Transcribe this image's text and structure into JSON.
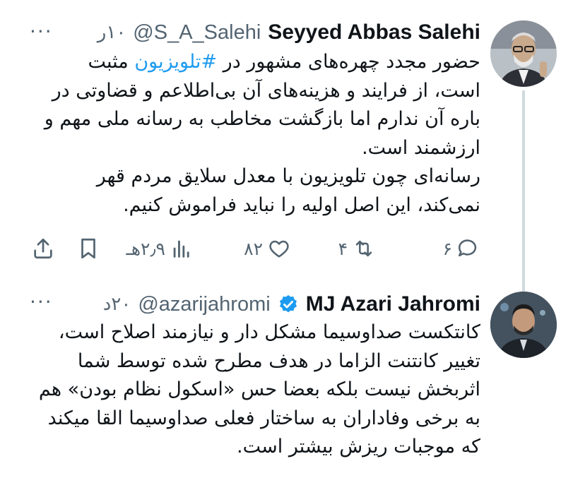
{
  "tweets": [
    {
      "name": "Seyyed Abbas Salehi",
      "handle": "@S_A_Salehi",
      "time": "۱۰ر",
      "verified": false,
      "text_line1_pre": "حضور مجدد چهره‌های مشهور در ",
      "hashtag": "#تلویزیون",
      "text_line1_post": " مثبت",
      "text_rest": "است، از فرایند و هزینه‌های آن بی‌اطلاعم و قضاوتی در باره آن ندارم اما بازگشت مخاطب به رسانه ملی مهم و ارزشمند است.\nرسانه‌ای چون تلویزیون با  معدل سلایق مردم قهر نمی‌کند، این اصل اولیه را نباید فراموش کنیم.",
      "stats": {
        "replies": "۶",
        "retweets": "۴",
        "likes": "۸۲",
        "views": "۲٫۹هـ"
      },
      "icons": [
        "reply-icon",
        "retweet-icon",
        "like-icon",
        "views-icon",
        "bookmark-icon",
        "share-icon"
      ]
    },
    {
      "name": "MJ Azari Jahromi",
      "handle": "@azarijahromi",
      "time": "۲۰د",
      "verified": true,
      "text": "کانتکست صداوسیما مشکل دار و نیازمند اصلاح است، تغییر کانتنت الزاما در هدف مطرح شده توسط شما اثربخش نیست بلکه بعضا حس «اسکول نظام بودن» هم به برخی وفاداران به ساختار فعلی صداوسیما القا میکند که موجبات ریزش بیشتر است."
    }
  ],
  "colors": {
    "text": "#0f1419",
    "secondary": "#536471",
    "link": "#1d9bf0",
    "thread": "#cfd9de",
    "verified": "#1d9bf0"
  },
  "more_label": "···"
}
